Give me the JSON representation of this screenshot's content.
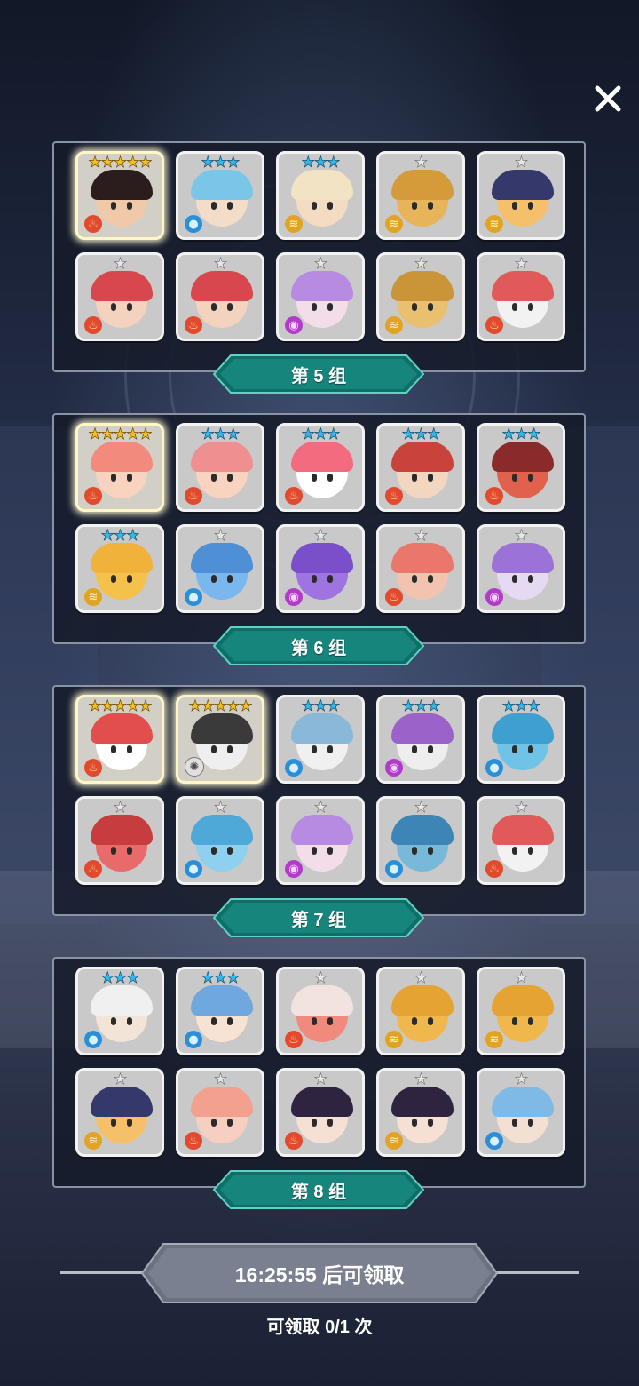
{
  "close_icon": "close-icon",
  "groups": [
    {
      "label": "第 5 组",
      "cards": [
        {
          "stars": 5,
          "element": "fire",
          "skin": "#f0c9a8",
          "hair": "#2b1d1d"
        },
        {
          "stars": 3,
          "element": "water",
          "skin": "#f3dcc8",
          "hair": "#79c6e8"
        },
        {
          "stars": 3,
          "element": "wind",
          "skin": "#f4dcc2",
          "hair": "#f1e3c4"
        },
        {
          "stars": 1,
          "element": "wind",
          "skin": "#e7b45a",
          "hair": "#d59a3a"
        },
        {
          "stars": 1,
          "element": "wind",
          "skin": "#f6c06a",
          "hair": "#34386a"
        },
        {
          "stars": 1,
          "element": "fire",
          "skin": "#f3d3bd",
          "hair": "#d9474e"
        },
        {
          "stars": 1,
          "element": "fire",
          "skin": "#f3d3bd",
          "hair": "#d9474e"
        },
        {
          "stars": 1,
          "element": "dark",
          "skin": "#f3dde8",
          "hair": "#b88be3"
        },
        {
          "stars": 1,
          "element": "wind",
          "skin": "#e8c070",
          "hair": "#c99538"
        },
        {
          "stars": 1,
          "element": "fire",
          "skin": "#f2f2f2",
          "hair": "#e05a5a"
        }
      ]
    },
    {
      "label": "第 6 组",
      "cards": [
        {
          "stars": 5,
          "element": "fire",
          "skin": "#f7d3c0",
          "hair": "#f28a7d"
        },
        {
          "stars": 3,
          "element": "fire",
          "skin": "#f7d3c0",
          "hair": "#f08f8f"
        },
        {
          "stars": 3,
          "element": "fire",
          "skin": "#ffffff",
          "hair": "#f26b7e"
        },
        {
          "stars": 3,
          "element": "fire",
          "skin": "#f3d6c0",
          "hair": "#c9423b"
        },
        {
          "stars": 3,
          "element": "fire",
          "skin": "#e1614d",
          "hair": "#8a2a2a"
        },
        {
          "stars": 3,
          "element": "wind",
          "skin": "#f4c24a",
          "hair": "#f0b23a"
        },
        {
          "stars": 1,
          "element": "water",
          "skin": "#7ab7ef",
          "hair": "#4f8fd6"
        },
        {
          "stars": 1,
          "element": "dark",
          "skin": "#a074e0",
          "hair": "#7a4fc9"
        },
        {
          "stars": 1,
          "element": "fire",
          "skin": "#f3c3b0",
          "hair": "#e9776c"
        },
        {
          "stars": 1,
          "element": "dark",
          "skin": "#e6d9f3",
          "hair": "#9a72d8"
        }
      ]
    },
    {
      "label": "第 7 组",
      "cards": [
        {
          "stars": 5,
          "element": "fire",
          "skin": "#ffffff",
          "hair": "#e24e4e"
        },
        {
          "stars": 5,
          "element": "light",
          "skin": "#efefef",
          "hair": "#3a3a3a"
        },
        {
          "stars": 3,
          "element": "water",
          "skin": "#f0f0f0",
          "hair": "#89b8d8"
        },
        {
          "stars": 3,
          "element": "dark",
          "skin": "#eeeeee",
          "hair": "#9b63c9"
        },
        {
          "stars": 3,
          "element": "water",
          "skin": "#6fc3e6",
          "hair": "#3f9fcf"
        },
        {
          "stars": 1,
          "element": "fire",
          "skin": "#e86a6a",
          "hair": "#c73c3c"
        },
        {
          "stars": 1,
          "element": "water",
          "skin": "#8fd0ef",
          "hair": "#4ea8d8"
        },
        {
          "stars": 1,
          "element": "dark",
          "skin": "#f3dde8",
          "hair": "#b88be3"
        },
        {
          "stars": 1,
          "element": "water",
          "skin": "#78b8d8",
          "hair": "#3d85b5"
        },
        {
          "stars": 1,
          "element": "fire",
          "skin": "#f2f2f2",
          "hair": "#e05a5a"
        }
      ]
    },
    {
      "label": "第 8 组",
      "cards": [
        {
          "stars": 3,
          "element": "water",
          "skin": "#f3e4d8",
          "hair": "#f0f0f0"
        },
        {
          "stars": 3,
          "element": "water",
          "skin": "#f6e3d2",
          "hair": "#6fa7df"
        },
        {
          "stars": 1,
          "element": "fire",
          "skin": "#f08a7c",
          "hair": "#f3e3e0"
        },
        {
          "stars": 1,
          "element": "wind",
          "skin": "#f0b84c",
          "hair": "#e4a332"
        },
        {
          "stars": 1,
          "element": "wind",
          "skin": "#f0b84c",
          "hair": "#e4a332"
        },
        {
          "stars": 1,
          "element": "wind",
          "skin": "#f6c06a",
          "hair": "#34386a"
        },
        {
          "stars": 1,
          "element": "fire",
          "skin": "#f7cfc0",
          "hair": "#f4a08f"
        },
        {
          "stars": 1,
          "element": "fire",
          "skin": "#f6e0d3",
          "hair": "#2e2440"
        },
        {
          "stars": 1,
          "element": "wind",
          "skin": "#f6e0d3",
          "hair": "#2e2440"
        },
        {
          "stars": 1,
          "element": "water",
          "skin": "#f3e0d2",
          "hair": "#7fb9e6"
        }
      ]
    }
  ],
  "claim": {
    "button_label": "16:25:55 后可领取",
    "count_label": "可领取 0/1 次"
  }
}
